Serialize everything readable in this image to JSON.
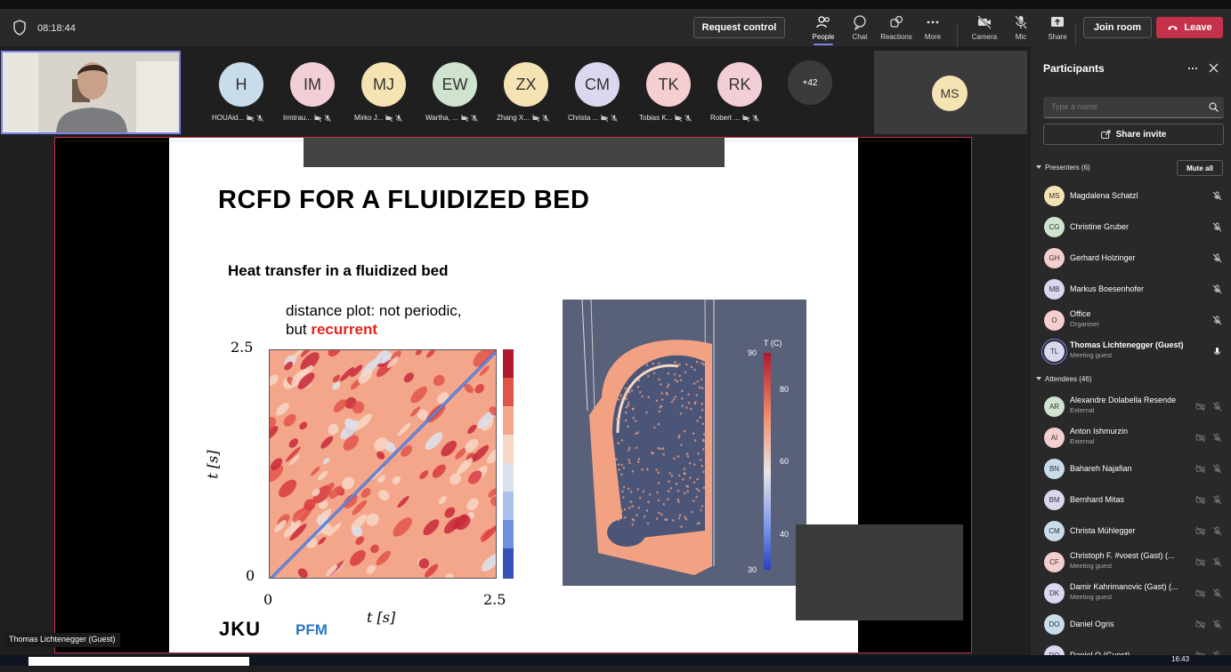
{
  "topbar": {
    "timer": "08:18:44",
    "request_control": "Request control",
    "tools": [
      {
        "label": "People",
        "icon": "people-icon"
      },
      {
        "label": "Chat",
        "icon": "chat-icon"
      },
      {
        "label": "Reactions",
        "icon": "reactions-icon"
      },
      {
        "label": "More",
        "icon": "more-icon"
      },
      {
        "label": "Camera",
        "icon": "camera-off-icon"
      },
      {
        "label": "Mic",
        "icon": "mic-off-icon"
      },
      {
        "label": "Share",
        "icon": "share-icon"
      }
    ],
    "join_room": "Join room",
    "leave": "Leave"
  },
  "strip": {
    "participants": [
      {
        "initials": "H",
        "name": "HOUAid...",
        "color": "#c8dcea"
      },
      {
        "initials": "IM",
        "name": "Irmtrau...",
        "color": "#f2cfd6"
      },
      {
        "initials": "MJ",
        "name": "Mirko J...",
        "color": "#f6e3b4"
      },
      {
        "initials": "EW",
        "name": "Wartha, ...",
        "color": "#cfe3cf"
      },
      {
        "initials": "ZX",
        "name": "Zhang X...",
        "color": "#f6e3b4"
      },
      {
        "initials": "CM",
        "name": "Christa ...",
        "color": "#d9d8ee"
      },
      {
        "initials": "TK",
        "name": "Tobias K...",
        "color": "#f5cfcf"
      },
      {
        "initials": "RK",
        "name": "Robert ...",
        "color": "#f2cfd6"
      }
    ],
    "more_count": "+42",
    "ms_initials": "MS"
  },
  "slide": {
    "title": "RCFD FOR A FLUIDIZED BED",
    "subtitle": "Heat transfer in a fluidized bed",
    "caption_line1": "distance plot: not periodic,",
    "caption_line2_prefix": "but ",
    "caption_line2_highlight": "recurrent",
    "plot": {
      "y_tick_top": "2.5",
      "y_tick_bottom": "0",
      "x_tick_left": "0",
      "x_tick_right": "2.5",
      "y_label": "t [s]",
      "x_label": "t [s]"
    },
    "colorbar": {
      "title": "T (C)",
      "ticks": [
        "90",
        "80",
        "60",
        "40",
        "30"
      ]
    },
    "logo_jku": "JKU",
    "logo_pfm": "PFM"
  },
  "presenter_name_tag": "Thomas Lichtenegger (Guest)",
  "panel": {
    "title": "Participants",
    "search_placeholder": "Type a name",
    "share_invite": "Share invite",
    "presenters_header": "Presenters (6)",
    "mute_all": "Mute all",
    "presenters": [
      {
        "initials": "MS",
        "name": "Magdalena Schatzl",
        "sub": "",
        "color": "#f6e3b4"
      },
      {
        "initials": "CG",
        "name": "Christine Gruber",
        "sub": "",
        "color": "#cfe3cf"
      },
      {
        "initials": "GH",
        "name": "Gerhard Holzinger",
        "sub": "",
        "color": "#f5cfcf"
      },
      {
        "initials": "MB",
        "name": "Markus Boesenhofer",
        "sub": "",
        "color": "#d9d8ee"
      },
      {
        "initials": "O",
        "name": "Office",
        "sub": "Organiser",
        "color": "#f5cfcf"
      },
      {
        "initials": "TL",
        "name": "Thomas Lichtenegger (Guest)",
        "sub": "Meeting guest",
        "color": "#d9d8ee"
      }
    ],
    "attendees_header": "Attendees (46)",
    "attendees": [
      {
        "initials": "AR",
        "name": "Alexandre Dolabella Resende",
        "sub": "External",
        "color": "#cfe3cf"
      },
      {
        "initials": "AI",
        "name": "Anton Ishmurzin",
        "sub": "External",
        "color": "#f5cfcf"
      },
      {
        "initials": "BN",
        "name": "Bahareh Najafian",
        "sub": "",
        "color": "#c8dcea"
      },
      {
        "initials": "BM",
        "name": "Bernhard Mitas",
        "sub": "",
        "color": "#d9d8ee"
      },
      {
        "initials": "CM",
        "name": "Christa Mühlegger",
        "sub": "",
        "color": "#c8dcea"
      },
      {
        "initials": "CF",
        "name": "Christoph F. #voest (Gast) (...",
        "sub": "Meeting guest",
        "color": "#f5cfcf"
      },
      {
        "initials": "DK",
        "name": "Damir Kahrimanovic (Gast) (...",
        "sub": "Meeting guest",
        "color": "#d9d8ee"
      },
      {
        "initials": "DO",
        "name": "Daniel Ogris",
        "sub": "",
        "color": "#c8dcea"
      },
      {
        "initials": "DQ",
        "name": "Daniel Q (Guest)",
        "sub": "",
        "color": "#d9d8ee"
      }
    ]
  },
  "taskbar": {
    "time": "16:43"
  },
  "colors": {
    "accent": "#7b83eb",
    "leave": "#c4314b",
    "panel_bg": "#292929"
  }
}
